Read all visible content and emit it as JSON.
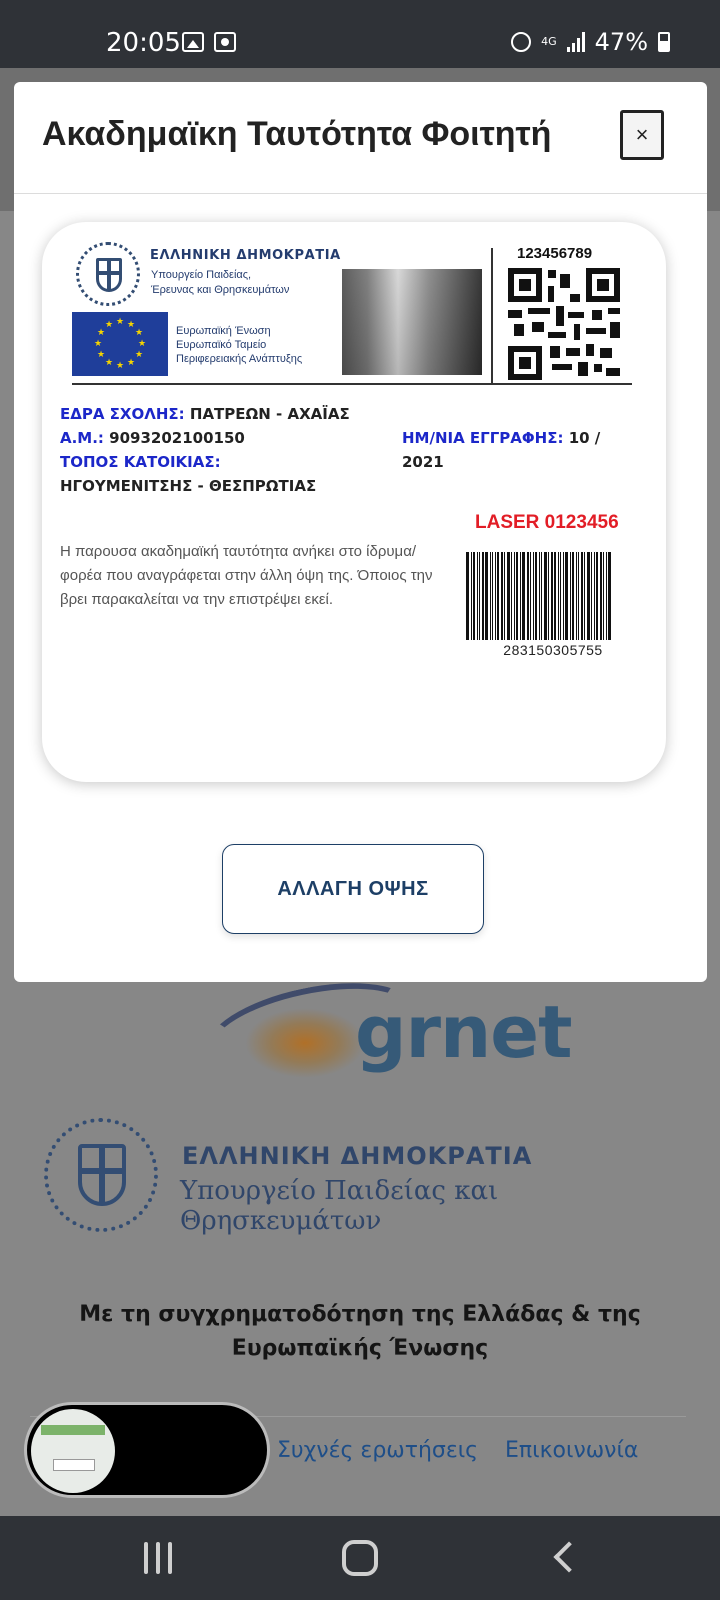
{
  "status_bar": {
    "time": "20:05",
    "network": "4G",
    "battery": "47%"
  },
  "modal": {
    "title": "Ακαδημαϊκη Ταυτότητα Φοιτητή",
    "close_label": "×",
    "flip_button_label": "ΑΛΛΑΓΗ ΟΨΗΣ"
  },
  "card": {
    "republic_title": "ΕΛΛΗΝΙΚΗ ΔΗΜΟΚΡΑΤΙΑ",
    "ministry_line1": "Υπουργείο Παιδείας,",
    "ministry_line2": "Έρευνας και Θρησκευμάτων",
    "eu_line1": "Ευρωπαϊκή Ένωση",
    "eu_line2": "Ευρωπαϊκό Ταμείο",
    "eu_line3": "Περιφερειακής Ανάπτυξης",
    "qr_number": "123456789",
    "faculty_label": "ΕΔΡΑ ΣΧΟΛΗΣ:",
    "faculty_value": "ΠΑΤΡΕΩΝ - ΑΧΑΪΑΣ",
    "am_label": "Α.Μ.:",
    "am_value": "9093202100150",
    "residence_label": "ΤΟΠΟΣ ΚΑΤΟΙΚΙΑΣ:",
    "residence_value": "ΗΓΟΥΜΕΝΙΤΣΗΣ - ΘΕΣΠΡΩΤΙΑΣ",
    "regdate_label": "ΗΜ/ΝΙΑ ΕΓΓΡΑΦΗΣ:",
    "regdate_value": "10 / 2021",
    "note": "Η παρουσα ακαδημαϊκή ταυτότητα ανήκει στο ίδρυμα/φορέα που αναγράφεται στην άλλη όψη της. Όποιος την βρει παρακαλείται να την επιστρέψει εκεί.",
    "laser": "LASER 0123456",
    "barcode_number": "283150305755"
  },
  "background_page": {
    "grnet_logo_text": "grnet",
    "republic_title": "ΕΛΛΗΝΙΚΗ ΔΗΜΟΚΡΑΤΙΑ",
    "ministry": "Υπουργείο Παιδείας και Θρησκευμάτων",
    "cofunding": "Με τη συγχρηματοδότηση της Ελλάδας & της Ευρωπαϊκής Ένωσης",
    "footer_links": [
      "Συχνές ερωτήσεις",
      "Επικοινωνία"
    ]
  },
  "colors": {
    "label_blue": "#1c27c9",
    "laser_red": "#e21d26",
    "button_navy": "#1d3f66",
    "overlay_gray": "#878787"
  },
  "icons": [
    "image-icon",
    "screen-record-icon",
    "alarm-icon",
    "signal-icon",
    "battery-icon",
    "qr-code-icon",
    "barcode-icon",
    "recents-icon",
    "home-icon",
    "back-icon"
  ]
}
